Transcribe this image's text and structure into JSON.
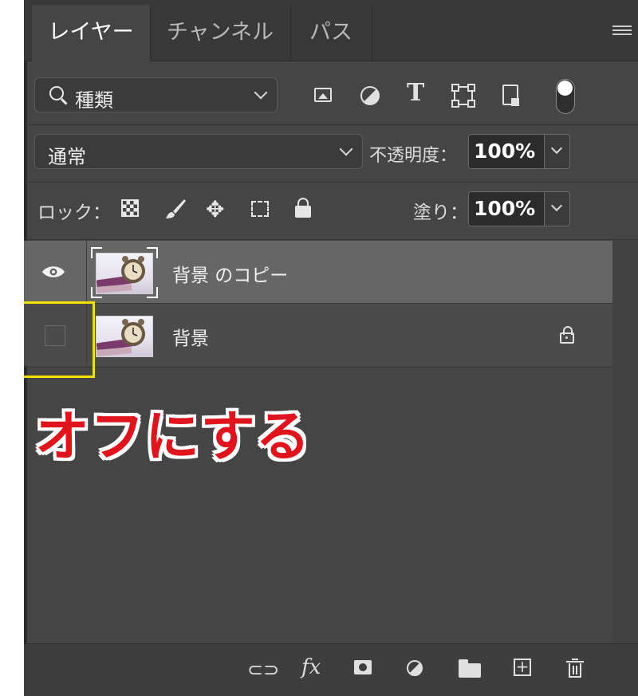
{
  "tabs": [
    {
      "label": "レイヤー",
      "active": true
    },
    {
      "label": "チャンネル",
      "active": false
    },
    {
      "label": "パス",
      "active": false
    }
  ],
  "filter": {
    "label": "種類",
    "icons": [
      "pixel-filter-icon",
      "adjustment-filter-icon",
      "type-filter-icon",
      "shape-filter-icon",
      "smart-object-filter-icon",
      "filter-toggle"
    ]
  },
  "blend": {
    "mode": "通常",
    "opacity_label": "不透明度：",
    "opacity": "100%"
  },
  "lock": {
    "label": "ロック：",
    "fill_label": "塗り：",
    "fill": "100%"
  },
  "layers": [
    {
      "name": "背景 のコピー",
      "visible": true,
      "selected": true,
      "locked": false
    },
    {
      "name": "背景",
      "visible": false,
      "selected": false,
      "locked": true
    }
  ],
  "annotation": {
    "text": "オフにする",
    "text_color": "#e0141d",
    "highlight_color": "#f5e100"
  },
  "colors": {
    "panel": "#454545",
    "selected_row": "#666666"
  }
}
